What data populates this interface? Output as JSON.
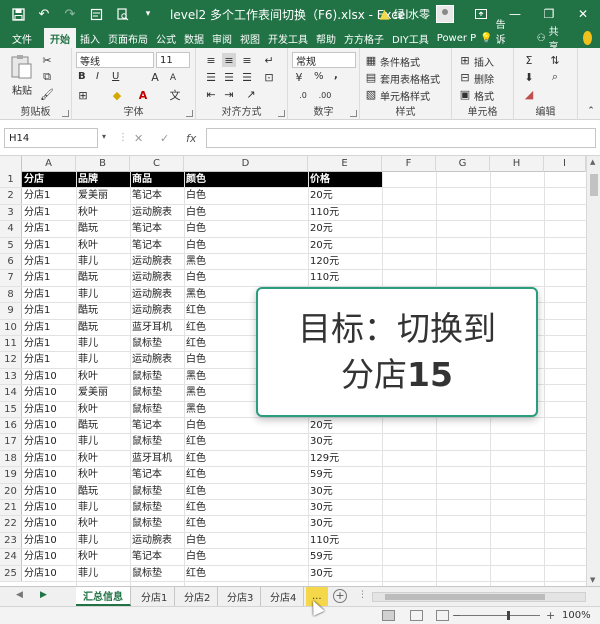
{
  "window": {
    "title": "level2 多个工作表间切换（F6).xlsx  -  Excel",
    "user": "绿 水零",
    "minimize": "—",
    "restore": "❐",
    "close": "✕"
  },
  "tabs": [
    "文件",
    "开始",
    "插入",
    "页面布局",
    "公式",
    "数据",
    "审阅",
    "视图",
    "开发工具",
    "帮助",
    "方方格子",
    "DIY工具",
    "Power P"
  ],
  "active_tab": "开始",
  "tell_me": "告诉我",
  "share": "共享",
  "ribbon": {
    "paste_label": "粘贴",
    "clipboard_label": "剪贴板",
    "font_name": "等线",
    "font_size": "11",
    "bold": "B",
    "italic": "I",
    "underline": "U",
    "font_label": "字体",
    "align_label": "对齐方式",
    "number_format": "常规",
    "percent": "%",
    "comma": ",",
    "number_label": "数字",
    "cond_format": "条件格式",
    "table_format": "套用表格格式",
    "cell_style": "单元格样式",
    "styles_label": "样式",
    "insert": "插入",
    "delete": "删除",
    "format": "格式",
    "cells_label": "单元格",
    "editing_label": "编辑"
  },
  "formula_bar": {
    "name_box": "H14",
    "fx": "fx",
    "cancel": "✕",
    "confirm": "✓",
    "content": ""
  },
  "columns": [
    "A",
    "B",
    "C",
    "D",
    "E",
    "F",
    "G",
    "H",
    "I"
  ],
  "header_row": [
    "分店",
    "品牌",
    "商品",
    "颜色",
    "价格"
  ],
  "rows": [
    [
      "分店1",
      "爱美丽",
      "笔记本",
      "白色",
      "20元"
    ],
    [
      "分店1",
      "秋叶",
      "运动腕表",
      "白色",
      "110元"
    ],
    [
      "分店1",
      "酷玩",
      "笔记本",
      "白色",
      "20元"
    ],
    [
      "分店1",
      "秋叶",
      "笔记本",
      "白色",
      "20元"
    ],
    [
      "分店1",
      "菲儿",
      "运动腕表",
      "黑色",
      "120元"
    ],
    [
      "分店1",
      "酷玩",
      "运动腕表",
      "白色",
      "110元"
    ],
    [
      "分店1",
      "菲儿",
      "运动腕表",
      "黑色",
      ""
    ],
    [
      "分店1",
      "酷玩",
      "运动腕表",
      "红色",
      ""
    ],
    [
      "分店1",
      "酷玩",
      "蓝牙耳机",
      "红色",
      ""
    ],
    [
      "分店1",
      "菲儿",
      "鼠标垫",
      "红色",
      ""
    ],
    [
      "分店1",
      "菲儿",
      "运动腕表",
      "白色",
      ""
    ],
    [
      "分店10",
      "秋叶",
      "鼠标垫",
      "黑色",
      ""
    ],
    [
      "分店10",
      "爱美丽",
      "鼠标垫",
      "黑色",
      ""
    ],
    [
      "分店10",
      "秋叶",
      "鼠标垫",
      "黑色",
      ""
    ],
    [
      "分店10",
      "酷玩",
      "笔记本",
      "白色",
      "20元"
    ],
    [
      "分店10",
      "菲儿",
      "鼠标垫",
      "红色",
      "30元"
    ],
    [
      "分店10",
      "秋叶",
      "蓝牙耳机",
      "红色",
      "129元"
    ],
    [
      "分店10",
      "秋叶",
      "笔记本",
      "红色",
      "59元"
    ],
    [
      "分店10",
      "酷玩",
      "鼠标垫",
      "红色",
      "30元"
    ],
    [
      "分店10",
      "菲儿",
      "鼠标垫",
      "红色",
      "30元"
    ],
    [
      "分店10",
      "秋叶",
      "鼠标垫",
      "红色",
      "30元"
    ],
    [
      "分店10",
      "菲儿",
      "运动腕表",
      "白色",
      "110元"
    ],
    [
      "分店10",
      "秋叶",
      "笔记本",
      "白色",
      "59元"
    ],
    [
      "分店10",
      "菲儿",
      "鼠标垫",
      "红色",
      "30元"
    ]
  ],
  "overlay": {
    "line1": "目标：切换到",
    "line2_prefix": "分店",
    "line2_number": "15"
  },
  "sheets": [
    "汇总信息",
    "分店1",
    "分店2",
    "分店3",
    "分店4"
  ],
  "active_sheet": "汇总信息",
  "sheet_more": "...",
  "add_sheet": "+",
  "status": {
    "zoom": "100%",
    "zoom_minus": "−",
    "zoom_plus": "+"
  },
  "colors": {
    "accent": "#217346",
    "overlay_border": "#2a9d7f",
    "highlight": "#f5d84a"
  }
}
